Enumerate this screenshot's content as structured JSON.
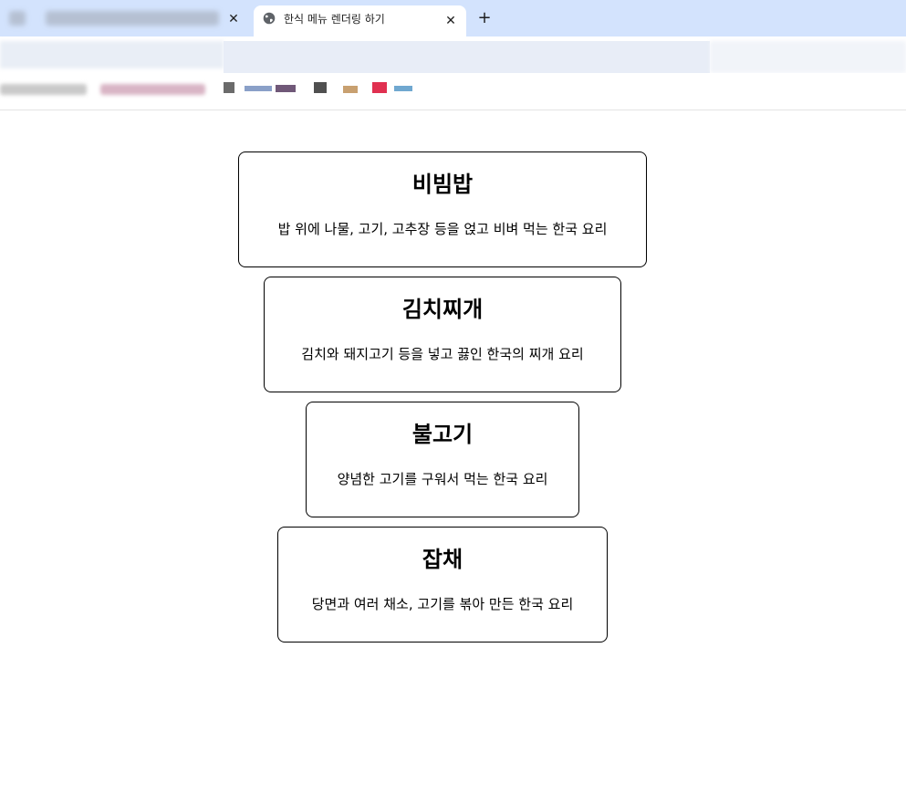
{
  "browser": {
    "active_tab_title": "한식 메뉴 렌더링 하기",
    "close_symbol": "✕",
    "new_tab_symbol": "+"
  },
  "menu": [
    {
      "name": "비빔밥",
      "description": "밥 위에 나물, 고기, 고추장 등을 얹고 비벼 먹는 한국 요리"
    },
    {
      "name": "김치찌개",
      "description": "김치와 돼지고기 등을 넣고 끓인 한국의 찌개 요리"
    },
    {
      "name": "불고기",
      "description": "양념한 고기를 구워서 먹는 한국 요리"
    },
    {
      "name": "잡채",
      "description": "당면과 여러 채소, 고기를 볶아 만든 한국 요리"
    }
  ],
  "colors": {
    "tabstrip": "#d3e3fd",
    "card_border": "#000000"
  }
}
